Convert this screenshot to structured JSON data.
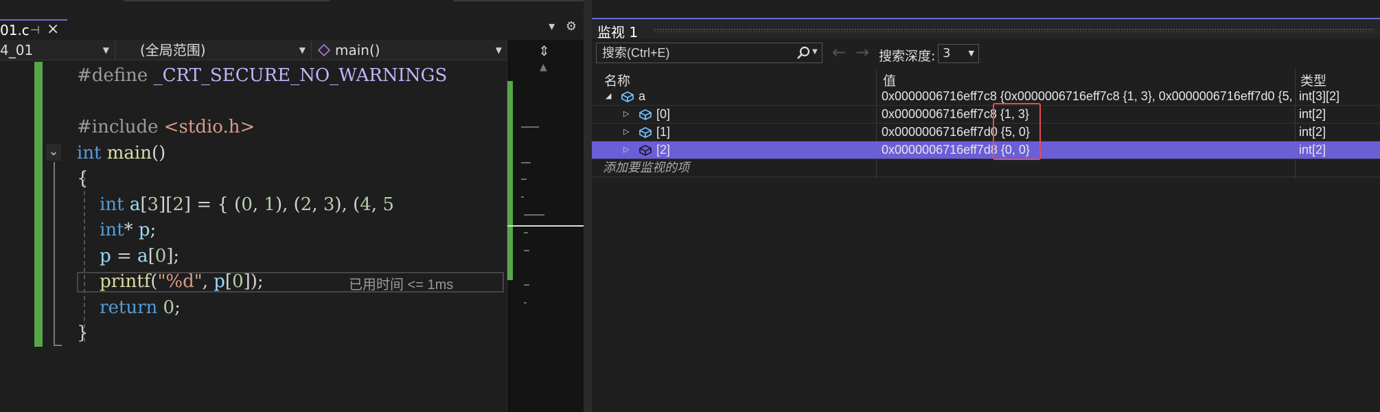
{
  "editor": {
    "tab_label": "01.c",
    "nav": {
      "project": "4_01",
      "scope": "(全局范围)",
      "function": "main()"
    },
    "code_lines": [
      {
        "tokens": [
          {
            "t": "#define ",
            "c": "pp"
          },
          {
            "t": "_CRT_SECURE_NO_WARNINGS",
            "c": "mac"
          }
        ]
      },
      {
        "tokens": []
      },
      {
        "tokens": [
          {
            "t": "#include ",
            "c": "pp"
          },
          {
            "t": "<stdio.h>",
            "c": "str"
          }
        ]
      },
      {
        "tokens": [
          {
            "t": "int ",
            "c": "kw"
          },
          {
            "t": "main",
            "c": "fn"
          },
          {
            "t": "()",
            "c": "pun"
          }
        ]
      },
      {
        "tokens": [
          {
            "t": "{",
            "c": "pun"
          }
        ]
      },
      {
        "tokens": [
          {
            "t": "    ",
            "c": "pun"
          },
          {
            "t": "int ",
            "c": "kw"
          },
          {
            "t": "a",
            "c": "var"
          },
          {
            "t": "[",
            "c": "pun"
          },
          {
            "t": "3",
            "c": "num"
          },
          {
            "t": "][",
            "c": "pun"
          },
          {
            "t": "2",
            "c": "num"
          },
          {
            "t": "] = { (",
            "c": "pun"
          },
          {
            "t": "0",
            "c": "num"
          },
          {
            "t": ", ",
            "c": "pun"
          },
          {
            "t": "1",
            "c": "num"
          },
          {
            "t": "), (",
            "c": "pun"
          },
          {
            "t": "2",
            "c": "num"
          },
          {
            "t": ", ",
            "c": "pun"
          },
          {
            "t": "3",
            "c": "num"
          },
          {
            "t": "), (",
            "c": "pun"
          },
          {
            "t": "4",
            "c": "num"
          },
          {
            "t": ", ",
            "c": "pun"
          },
          {
            "t": "5",
            "c": "num"
          }
        ]
      },
      {
        "tokens": [
          {
            "t": "    ",
            "c": "pun"
          },
          {
            "t": "int",
            "c": "kw"
          },
          {
            "t": "* ",
            "c": "pun"
          },
          {
            "t": "p",
            "c": "var"
          },
          {
            "t": ";",
            "c": "pun"
          }
        ]
      },
      {
        "tokens": [
          {
            "t": "    ",
            "c": "pun"
          },
          {
            "t": "p",
            "c": "var"
          },
          {
            "t": " = ",
            "c": "pun"
          },
          {
            "t": "a",
            "c": "var"
          },
          {
            "t": "[",
            "c": "pun"
          },
          {
            "t": "0",
            "c": "num"
          },
          {
            "t": "];",
            "c": "pun"
          }
        ]
      },
      {
        "tokens": [
          {
            "t": "    ",
            "c": "pun"
          },
          {
            "t": "printf",
            "c": "fn"
          },
          {
            "t": "(",
            "c": "pun"
          },
          {
            "t": "\"%d\"",
            "c": "str"
          },
          {
            "t": ", ",
            "c": "pun"
          },
          {
            "t": "p",
            "c": "var"
          },
          {
            "t": "[",
            "c": "pun"
          },
          {
            "t": "0",
            "c": "num"
          },
          {
            "t": "]);",
            "c": "pun"
          }
        ]
      },
      {
        "tokens": [
          {
            "t": "    ",
            "c": "pun"
          },
          {
            "t": "return ",
            "c": "kw"
          },
          {
            "t": "0",
            "c": "num"
          },
          {
            "t": ";",
            "c": "pun"
          }
        ]
      },
      {
        "tokens": [
          {
            "t": "}",
            "c": "pun"
          }
        ]
      }
    ],
    "elapsed_hint": "已用时间 <= 1ms"
  },
  "watch": {
    "title": "监视 1",
    "search_placeholder": "搜索(Ctrl+E)",
    "depth_label": "搜索深度:",
    "depth_value": "3",
    "columns": {
      "name": "名称",
      "value": "值",
      "type": "类型"
    },
    "rows": [
      {
        "name": "a",
        "value": "0x0000006716eff7c8 {0x0000006716eff7c8 {1, 3}, 0x0000006716eff7d0 {5,...",
        "type": "int[3][2]",
        "expanded": true
      },
      {
        "name": "[0]",
        "value": "0x0000006716eff7c8 {1, 3}",
        "type": "int[2]"
      },
      {
        "name": "[1]",
        "value": "0x0000006716eff7d0 {5, 0}",
        "type": "int[2]"
      },
      {
        "name": "[2]",
        "value": "0x0000006716eff7d8 {0, 0}",
        "type": "int[2]",
        "selected": true
      }
    ],
    "add_watch_label": "添加要监视的项"
  },
  "colors": {
    "accent": "#6b6bd6",
    "selection": "#6b5ed6",
    "change_bar": "#57a64a",
    "highlight_box": "#e44c56"
  }
}
